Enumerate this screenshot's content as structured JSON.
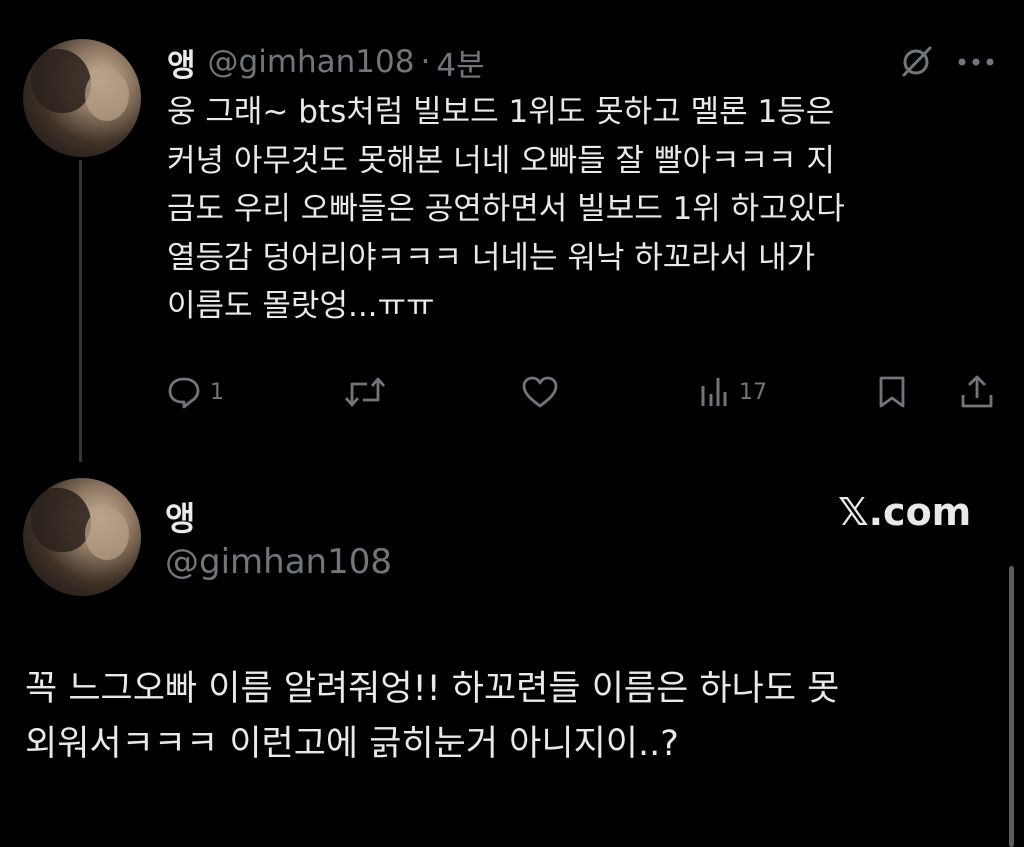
{
  "tweet1": {
    "display_name": "앵",
    "handle": "@gimhan108",
    "separator": "·",
    "time": "4분",
    "text": "웅 그래~ bts처럼 빌보드 1위도 못하고 멜론 1등은\n커녕 아무것도 못해본 너네 오빠들 잘 빨아ㅋㅋㅋ 지\n금도 우리 오빠들은 공연하면서 빌보드 1위 하고있다\n열등감 덩어리야ㅋㅋㅋ 너네는 워낙 하꼬라서 내가\n이름도 몰랏엉...ㅠㅠ",
    "actions": {
      "reply_count": "1",
      "retweet_count": "",
      "like_count": "",
      "views_count": "17"
    },
    "icons": {
      "avatar": "avatar",
      "grok": "grok-icon",
      "more": "more-icon",
      "reply": "reply-icon",
      "retweet": "retweet-icon",
      "like": "heart-icon",
      "views": "views-icon",
      "bookmark": "bookmark-icon",
      "share": "share-icon"
    }
  },
  "tweet2": {
    "display_name": "앵",
    "handle": "@gimhan108",
    "brand": "𝕏.com",
    "text": "꼭 느그오빠 이름 알려줘엉!! 하꼬련들 이름은 하나도 못\n외워서ㅋㅋㅋ 이런고에 긁히눈거 아니지이..?"
  },
  "colors": {
    "background": "#000000",
    "text": "#e7e9ea",
    "secondary": "#71767b",
    "thread_line": "#333639"
  }
}
